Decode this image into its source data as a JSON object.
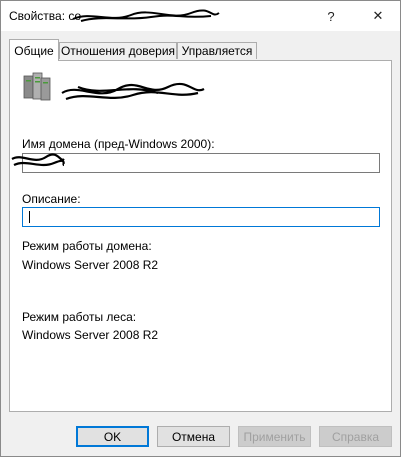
{
  "window": {
    "title": "Свойства: со",
    "help_glyph": "?",
    "close_glyph": "✕"
  },
  "tabs": [
    {
      "label": "Общие",
      "active": true
    },
    {
      "label": "Отношения доверия",
      "active": false
    },
    {
      "label": "Управляется",
      "active": false
    }
  ],
  "general": {
    "icon": "server-icon",
    "domain_name_label": "Имя домена (пред-Windows 2000):",
    "domain_name_value": "",
    "description_label": "Описание:",
    "description_value": "",
    "domain_mode_label": "Режим работы домена:",
    "domain_mode_value": "Windows Server 2008 R2",
    "forest_mode_label": "Режим работы леса:",
    "forest_mode_value": "Windows Server 2008 R2"
  },
  "buttons": {
    "ok": "OK",
    "cancel": "Отмена",
    "apply": "Применить",
    "help": "Справка"
  }
}
